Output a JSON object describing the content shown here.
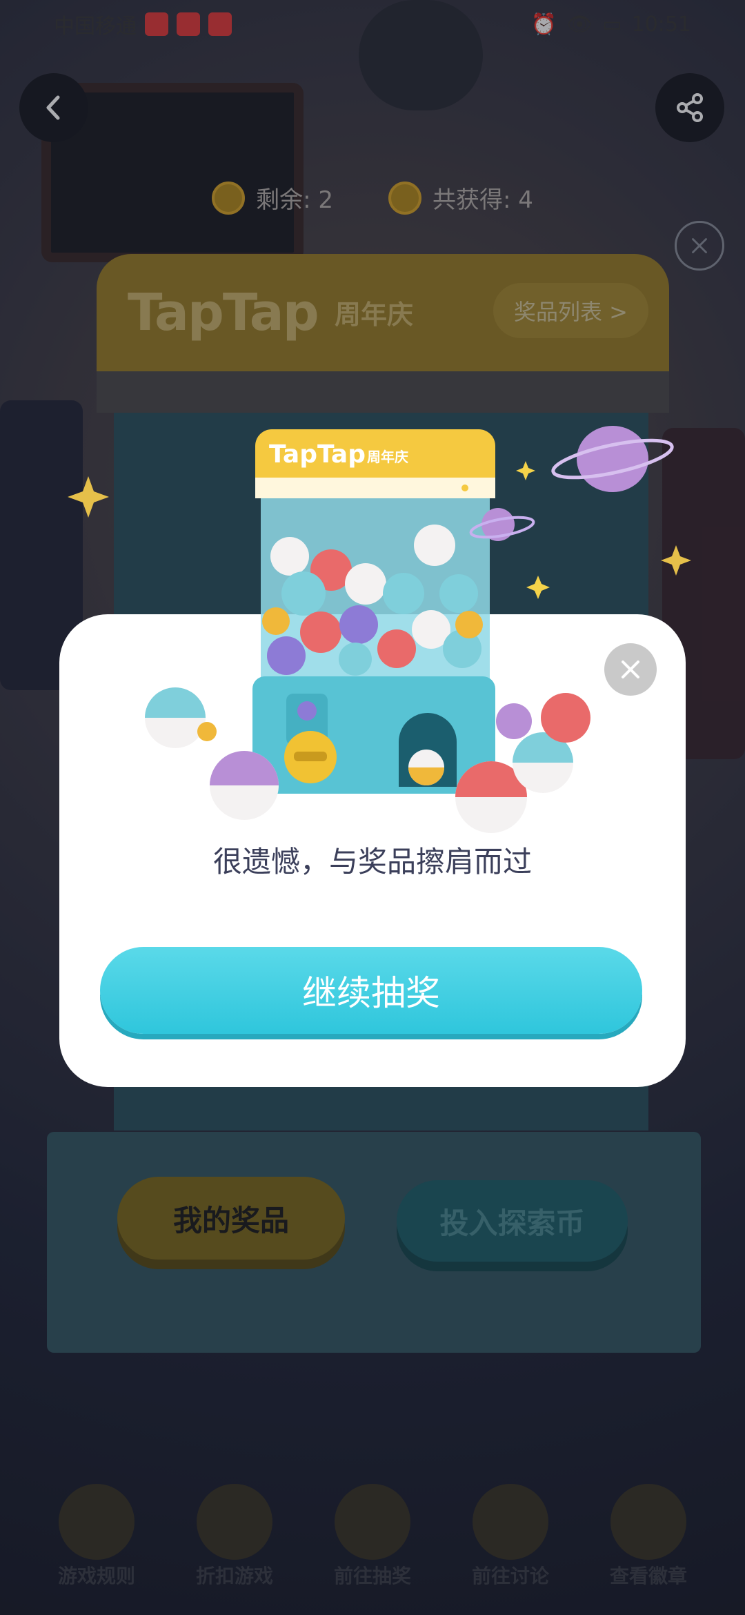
{
  "status_bar": {
    "carrier": "中国移通",
    "time": "10:51"
  },
  "header": {
    "back_icon": "back-arrow-icon",
    "share_icon": "share-icon"
  },
  "counters": {
    "remaining_label": "剩余: 2",
    "total_label": "共获得: 4"
  },
  "machine": {
    "brand": "TapTap",
    "subtitle": "周年庆",
    "prize_list_label": "奖品列表 >",
    "my_prizes_label": "我的奖品",
    "insert_coin_label": "投入探索币"
  },
  "illustration": {
    "brand": "TapTap",
    "subtitle": "周年庆"
  },
  "dialog": {
    "message": "很遗憾，与奖品擦肩而过",
    "continue_label": "继续抽奖"
  },
  "bottom_nav": {
    "items": [
      {
        "label": "游戏规则"
      },
      {
        "label": "折扣游戏"
      },
      {
        "label": "前往抽奖"
      },
      {
        "label": "前往讨论"
      },
      {
        "label": "查看徽章"
      }
    ]
  },
  "colors": {
    "accent_cyan": "#2fc6dc",
    "machine_yellow": "#f5c940",
    "dialog_bg": "#ffffff"
  }
}
